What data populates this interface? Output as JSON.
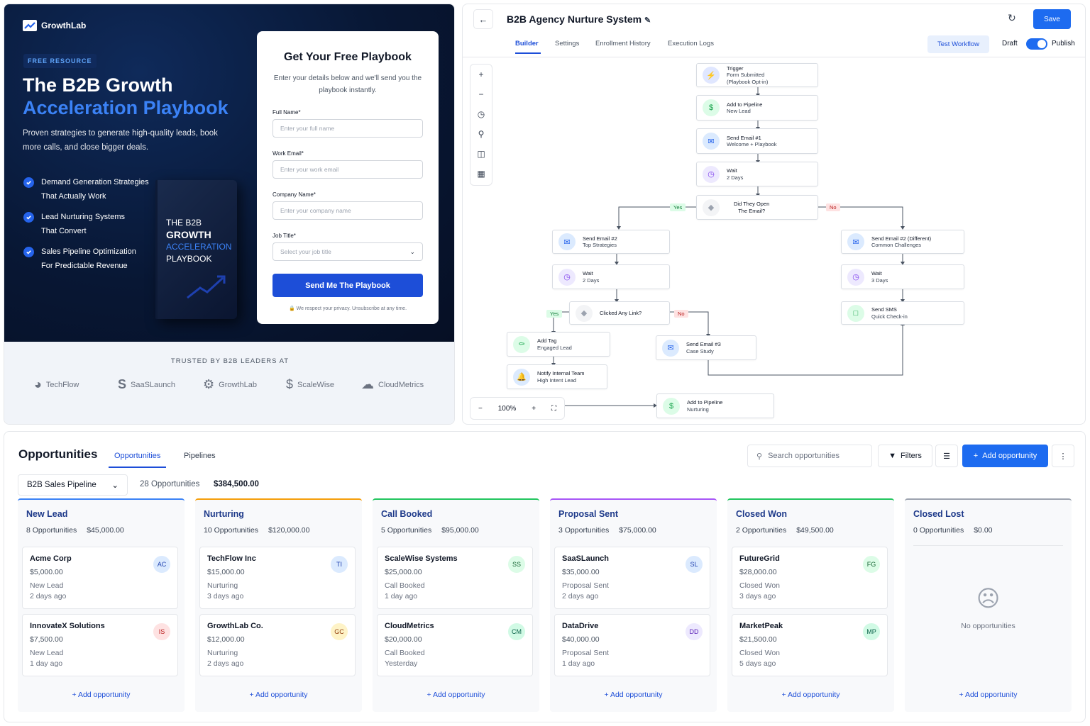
{
  "landing": {
    "logo": "GrowthLab",
    "badge": "FREE RESOURCE",
    "title_line1": "The B2B Growth",
    "title_line2": "Acceleration Playbook",
    "subtitle": "Proven strategies to generate high-quality leads, book more calls, and close bigger deals.",
    "features": [
      {
        "l1": "Demand Generation Strategies",
        "l2": "That Actually Work"
      },
      {
        "l1": "Lead Nurturing Systems",
        "l2": "That Convert"
      },
      {
        "l1": "Sales Pipeline Optimization",
        "l2": "For Predictable Revenue"
      }
    ],
    "book": {
      "l1": "THE B2B",
      "l2": "GROWTH",
      "l3": "ACCELERATION",
      "l4": "PLAYBOOK"
    },
    "form": {
      "title": "Get Your Free Playbook",
      "desc": "Enter your details below and we'll send you the playbook instantly.",
      "fields": [
        {
          "label": "Full Name*",
          "placeholder": "Enter your full name"
        },
        {
          "label": "Work Email*",
          "placeholder": "Enter your work email"
        },
        {
          "label": "Company Name*",
          "placeholder": "Enter your company name"
        },
        {
          "label": "Job Title*",
          "placeholder": "Select your job title"
        }
      ],
      "submit": "Send Me The Playbook",
      "privacy": "We respect your privacy. Unsubscribe at any time."
    },
    "trust": {
      "heading": "TRUSTED BY B2B LEADERS AT",
      "brands": [
        "TechFlow",
        "SaaSLaunch",
        "GrowthLab",
        "ScaleWise",
        "CloudMetrics"
      ]
    }
  },
  "workflow": {
    "title": "B2B Agency Nurture System",
    "save": "Save",
    "tabs": [
      "Builder",
      "Settings",
      "Enrollment History",
      "Execution Logs"
    ],
    "test": "Test Workflow",
    "draft": "Draft",
    "publish": "Publish",
    "zoom": "100%",
    "nodes": [
      {
        "t": "Trigger",
        "s": "Form Submitted",
        "s2": "(Playbook Opt-in)"
      },
      {
        "t": "Add to Pipeline",
        "s": "New Lead"
      },
      {
        "t": "Send Email #1",
        "s": "Welcome + Playbook"
      },
      {
        "t": "Wait",
        "s": "2 Days"
      },
      {
        "t": "Did They Open",
        "s": "The Email?"
      },
      {
        "t": "Send Email #2",
        "s": "Top Strategies"
      },
      {
        "t": "Wait",
        "s": "2 Days"
      },
      {
        "t": "Clicked Any Link?"
      },
      {
        "t": "Add Tag",
        "s": "Engaged Lead"
      },
      {
        "t": "Notify Internal Team",
        "s": "High Intent Lead"
      },
      {
        "t": "Send Email #3",
        "s": "Case Study"
      },
      {
        "t": "Add to Pipeline",
        "s": "Nurturing"
      },
      {
        "t": "Send Email #2 (Different)",
        "s": "Common Challenges"
      },
      {
        "t": "Wait",
        "s": "3 Days"
      },
      {
        "t": "Send SMS",
        "s": "Quick Check-in"
      }
    ],
    "yes": "Yes",
    "no": "No"
  },
  "opportunities": {
    "title": "Opportunities",
    "tabs": [
      "Opportunities",
      "Pipelines"
    ],
    "search_placeholder": "Search opportunities",
    "filters": "Filters",
    "add": "Add opportunity",
    "pipeline": "B2B Sales Pipeline",
    "count": "28 Opportunities",
    "total": "$384,500.00",
    "add_link": "+ Add opportunity",
    "empty": "No opportunities",
    "columns": [
      {
        "name": "New Lead",
        "count": "8 Opportunities",
        "value": "$45,000.00",
        "color": "#3b82f6",
        "cards": [
          {
            "name": "Acme Corp",
            "value": "$5,000.00",
            "stage": "New Lead",
            "time": "2 days ago",
            "initials": "AC",
            "bg": "#dbeafe",
            "fg": "#1e40af"
          },
          {
            "name": "InnovateX Solutions",
            "value": "$7,500.00",
            "stage": "New Lead",
            "time": "1 day ago",
            "initials": "IS",
            "bg": "#fee2e2",
            "fg": "#b91c1c"
          }
        ]
      },
      {
        "name": "Nurturing",
        "count": "10 Opportunities",
        "value": "$120,000.00",
        "color": "#f59e0b",
        "cards": [
          {
            "name": "TechFlow Inc",
            "value": "$15,000.00",
            "stage": "Nurturing",
            "time": "3 days ago",
            "initials": "TI",
            "bg": "#dbeafe",
            "fg": "#1e40af"
          },
          {
            "name": "GrowthLab Co.",
            "value": "$12,000.00",
            "stage": "Nurturing",
            "time": "2 days ago",
            "initials": "GC",
            "bg": "#fef3c7",
            "fg": "#92400e"
          }
        ]
      },
      {
        "name": "Call Booked",
        "count": "5 Opportunities",
        "value": "$95,000.00",
        "color": "#22c55e",
        "cards": [
          {
            "name": "ScaleWise Systems",
            "value": "$25,000.00",
            "stage": "Call Booked",
            "time": "1 day ago",
            "initials": "SS",
            "bg": "#dcfce7",
            "fg": "#166534"
          },
          {
            "name": "CloudMetrics",
            "value": "$20,000.00",
            "stage": "Call Booked",
            "time": "Yesterday",
            "initials": "CM",
            "bg": "#d1fae5",
            "fg": "#065f46"
          }
        ]
      },
      {
        "name": "Proposal Sent",
        "count": "3 Opportunities",
        "value": "$75,000.00",
        "color": "#a855f7",
        "cards": [
          {
            "name": "SaaSLaunch",
            "value": "$35,000.00",
            "stage": "Proposal Sent",
            "time": "2 days ago",
            "initials": "SL",
            "bg": "#dbeafe",
            "fg": "#1e40af"
          },
          {
            "name": "DataDrive",
            "value": "$40,000.00",
            "stage": "Proposal Sent",
            "time": "1 day ago",
            "initials": "DD",
            "bg": "#ede9fe",
            "fg": "#5b21b6"
          }
        ]
      },
      {
        "name": "Closed Won",
        "count": "2 Opportunities",
        "value": "$49,500.00",
        "color": "#22c55e",
        "cards": [
          {
            "name": "FutureGrid",
            "value": "$28,000.00",
            "stage": "Closed Won",
            "time": "3 days ago",
            "initials": "FG",
            "bg": "#dcfce7",
            "fg": "#166534"
          },
          {
            "name": "MarketPeak",
            "value": "$21,500.00",
            "stage": "Closed Won",
            "time": "5 days ago",
            "initials": "MP",
            "bg": "#d1fae5",
            "fg": "#065f46"
          }
        ]
      },
      {
        "name": "Closed Lost",
        "count": "0 Opportunities",
        "value": "$0.00",
        "color": "#9ca3af",
        "cards": []
      }
    ]
  }
}
